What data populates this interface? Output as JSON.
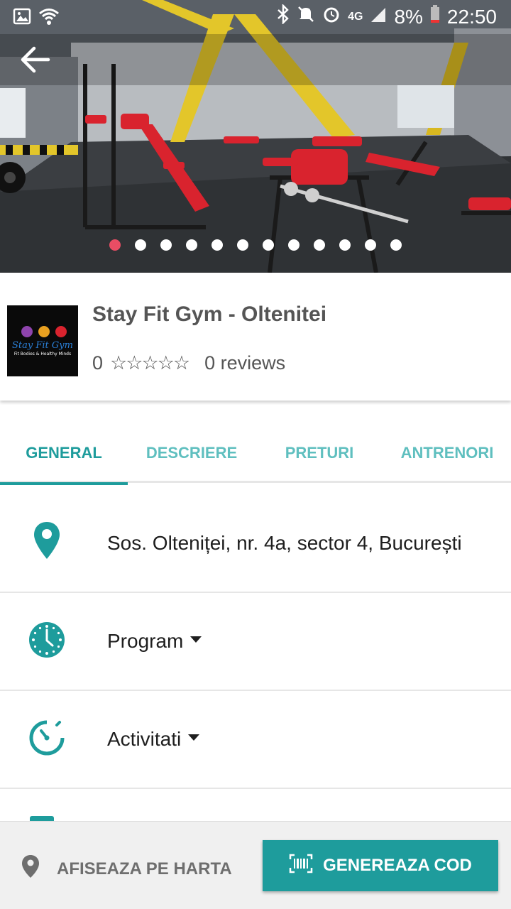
{
  "status_bar": {
    "battery": "8%",
    "time": "22:50",
    "network": "4G"
  },
  "gym": {
    "name": "Stay Fit Gym - Oltenitei",
    "rating": "0",
    "reviews": "0 reviews",
    "logo_text": "Stay Fit Gym",
    "logo_tagline": "Fit Bodies & Healthy Minds"
  },
  "gallery": {
    "count": 12,
    "active_index": 0
  },
  "tabs": [
    {
      "label": "GENERAL",
      "active": true
    },
    {
      "label": "DESCRIERE",
      "active": false
    },
    {
      "label": "PRETURI",
      "active": false
    },
    {
      "label": "ANTRENORI",
      "active": false
    }
  ],
  "info": {
    "address": "Sos. Olteniței, nr. 4a, sector 4, București",
    "program": "Program",
    "activitati": "Activitati"
  },
  "actions": {
    "map": "AFISEAZA PE HARTA",
    "code": "GENEREAZA COD"
  },
  "colors": {
    "accent": "#1e9c9c",
    "dot_active": "#e94d64"
  },
  "icons": [
    "back-arrow-icon",
    "location-pin-icon",
    "clock-icon",
    "timer-icon",
    "barcode-icon"
  ]
}
